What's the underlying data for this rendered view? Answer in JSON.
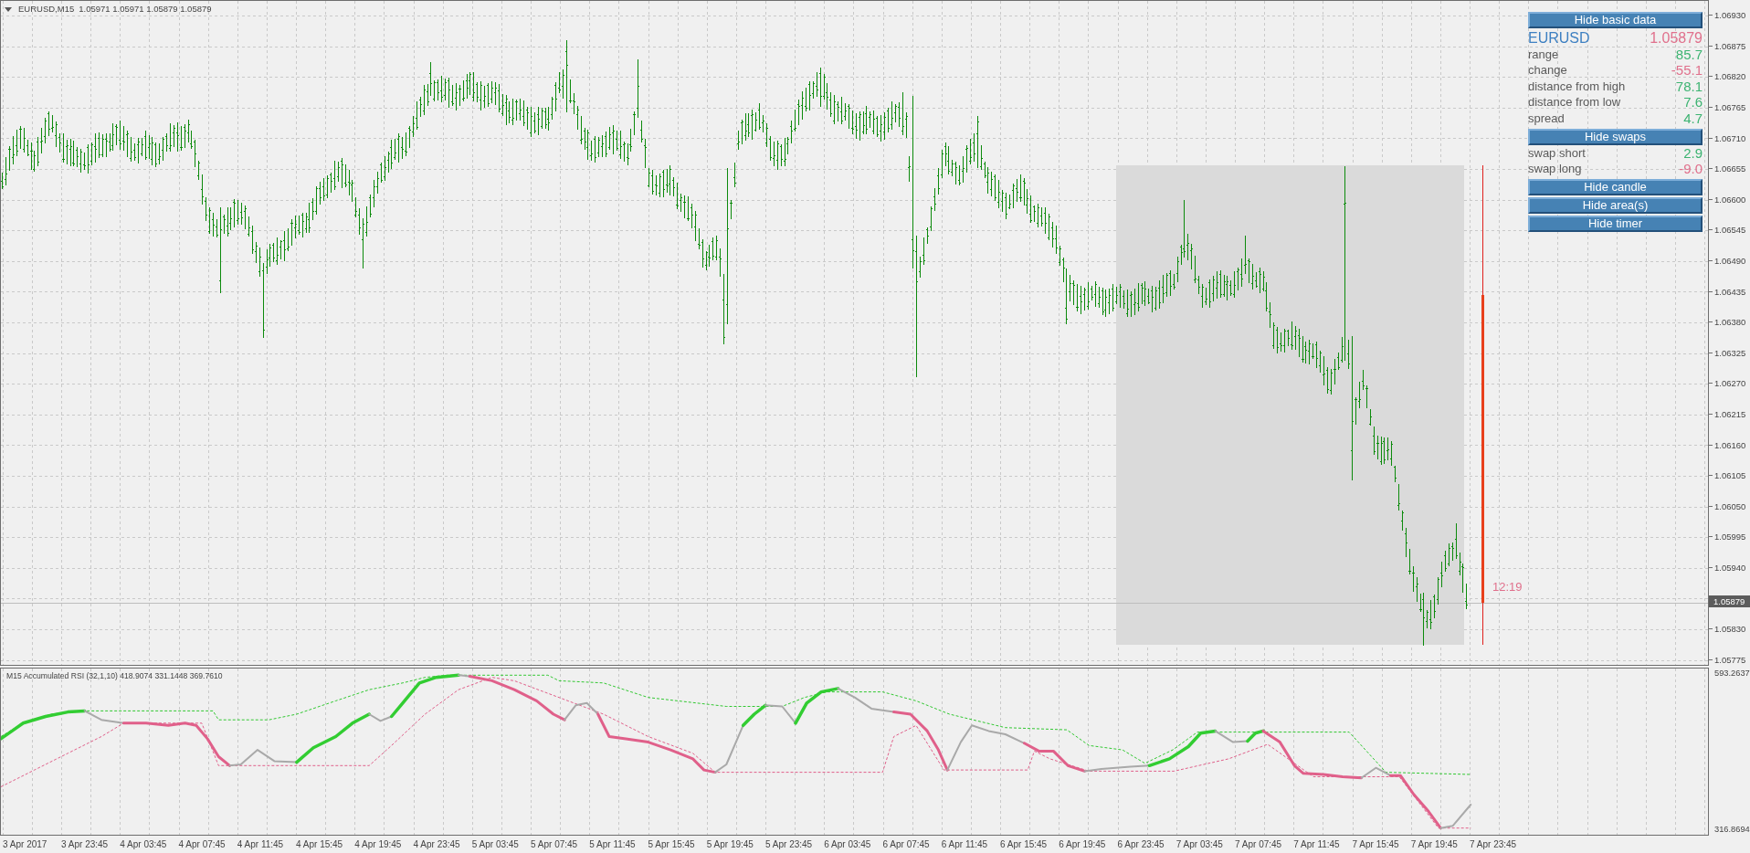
{
  "chart_header": {
    "symbol": "EURUSD,M15",
    "prices": "1.05971 1.05971 1.05879 1.05879"
  },
  "info_panel": {
    "sections": [
      {
        "button": "Hide basic data",
        "rows": [
          {
            "kind": "title",
            "label": "EURUSD",
            "value": "1.05879",
            "color": "#e0708c"
          },
          {
            "kind": "row",
            "label": "range",
            "value": "85.7",
            "color": "#3cb371"
          },
          {
            "kind": "row",
            "label": "change",
            "value": "-55.1",
            "color": "#e0708c"
          },
          {
            "kind": "row",
            "label": "distance from high",
            "value": "78.1",
            "color": "#3cb371"
          },
          {
            "kind": "row",
            "label": "distance from low",
            "value": "7.6",
            "color": "#3cb371"
          },
          {
            "kind": "row",
            "label": "spread",
            "value": "4.7",
            "color": "#3cb371"
          }
        ]
      },
      {
        "button": "Hide swaps",
        "rows": [
          {
            "kind": "row",
            "label": "swap short",
            "value": "2.9",
            "color": "#3cb371"
          },
          {
            "kind": "row",
            "label": "swap long",
            "value": "-9.0",
            "color": "#e0708c"
          }
        ]
      },
      {
        "button": "Hide candle"
      },
      {
        "button": "Hide area(s)"
      },
      {
        "button": "Hide timer"
      }
    ]
  },
  "candle_timer": "12:19",
  "price_axis": {
    "labels_above": [
      "1.06930",
      "1.06875",
      "1.06820",
      "1.06765",
      "1.06710",
      "1.06655",
      "1.06600",
      "1.06545",
      "1.06490",
      "1.06435",
      "1.06380",
      "1.06325",
      "1.06270",
      "1.06215",
      "1.06160",
      "1.06105",
      "1.06050",
      "1.05995",
      "1.05940"
    ],
    "current_price": "1.05879",
    "labels_below": [
      "1.05830",
      "1.05775"
    ]
  },
  "indicator": {
    "title": "M15 Accumulated RSI (32,1,10) 418.9074 331.1448 369.7610",
    "axis_labels": [
      "593.2637",
      "316.8694"
    ]
  },
  "time_axis": [
    "3 Apr 2017",
    "3 Apr 23:45",
    "4 Apr 03:45",
    "4 Apr 07:45",
    "4 Apr 11:45",
    "4 Apr 15:45",
    "4 Apr 19:45",
    "4 Apr 23:45",
    "5 Apr 03:45",
    "5 Apr 07:45",
    "5 Apr 11:45",
    "5 Apr 15:45",
    "5 Apr 19:45",
    "5 Apr 23:45",
    "6 Apr 03:45",
    "6 Apr 07:45",
    "6 Apr 11:45",
    "6 Apr 15:45",
    "6 Apr 19:45",
    "6 Apr 23:45",
    "7 Apr 03:45",
    "7 Apr 07:45",
    "7 Apr 11:45",
    "7 Apr 15:45",
    "7 Apr 19:45",
    "7 Apr 23:45"
  ]
}
